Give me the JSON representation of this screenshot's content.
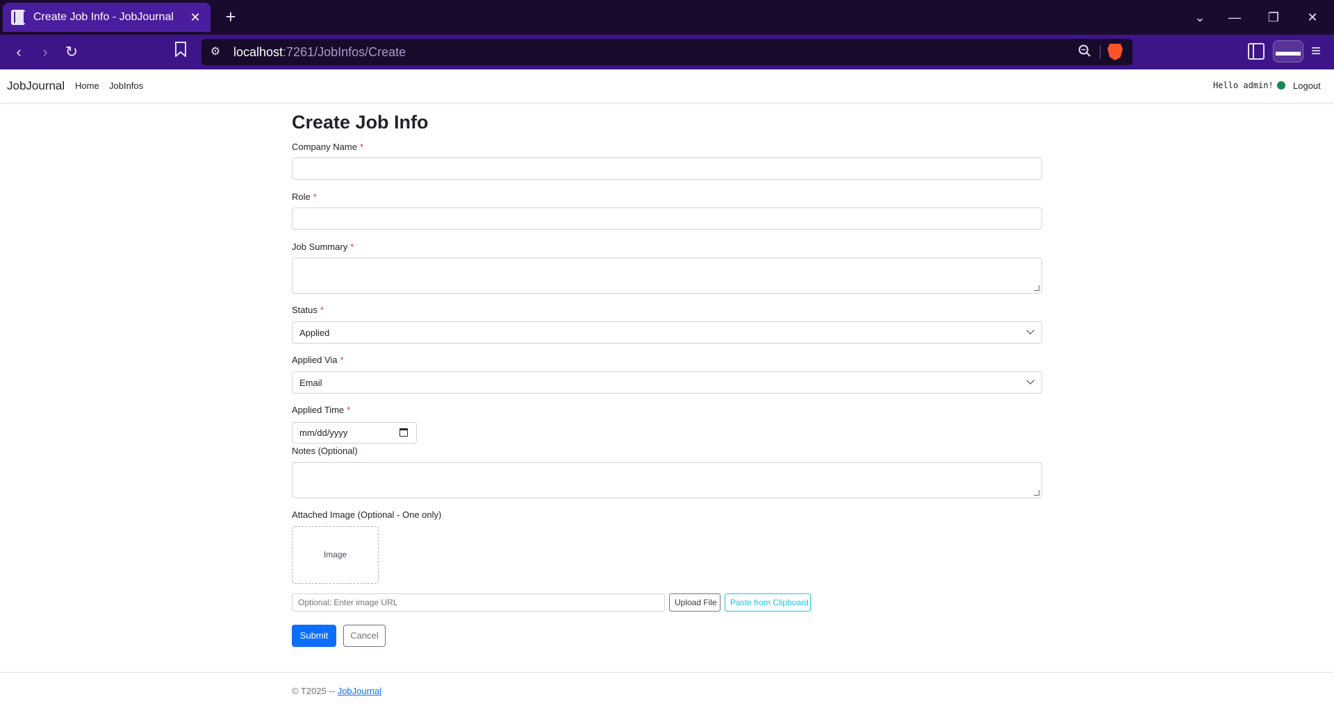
{
  "browser": {
    "tab_title": "Create Job Info - JobJournal",
    "tab_close": "✕",
    "new_tab": "+",
    "url_host": "localhost",
    "url_path": ":7261/JobInfos/Create",
    "window_controls": {
      "tabs": "⌄",
      "minimize": "—",
      "restore": "❐",
      "close": "✕"
    },
    "nav": {
      "back": "‹",
      "forward": "›",
      "reload": "↻"
    },
    "menu": "≡"
  },
  "app": {
    "brand": "JobJournal",
    "nav_links": [
      "Home",
      "JobInfos"
    ],
    "greeting": "Hello admin!",
    "status_color": "#198754",
    "logout": "Logout"
  },
  "form": {
    "title": "Create Job Info",
    "required_mark": "*",
    "company_name_label": "Company Name",
    "role_label": "Role",
    "job_summary_label": "Job Summary",
    "status_label": "Status",
    "status_value": "Applied",
    "applied_via_label": "Applied Via",
    "applied_via_value": "Email",
    "applied_time_label": "Applied Time",
    "applied_time_placeholder": "mm/dd/yyyy",
    "notes_label": "Notes (Optional)",
    "attached_image_label": "Attached Image (Optional - One only)",
    "image_placeholder": "Image",
    "image_url_placeholder": "Optional: Enter image URL",
    "upload_button": "Upload File",
    "paste_button": "Paste from Clipboard",
    "submit_button": "Submit",
    "cancel_button": "Cancel"
  },
  "footer": {
    "text": "© T2025 -- ",
    "link": "JobJournal"
  },
  "colors": {
    "primary": "#0d6efd",
    "required": "#dc3545",
    "info": "#0dcaf0"
  }
}
